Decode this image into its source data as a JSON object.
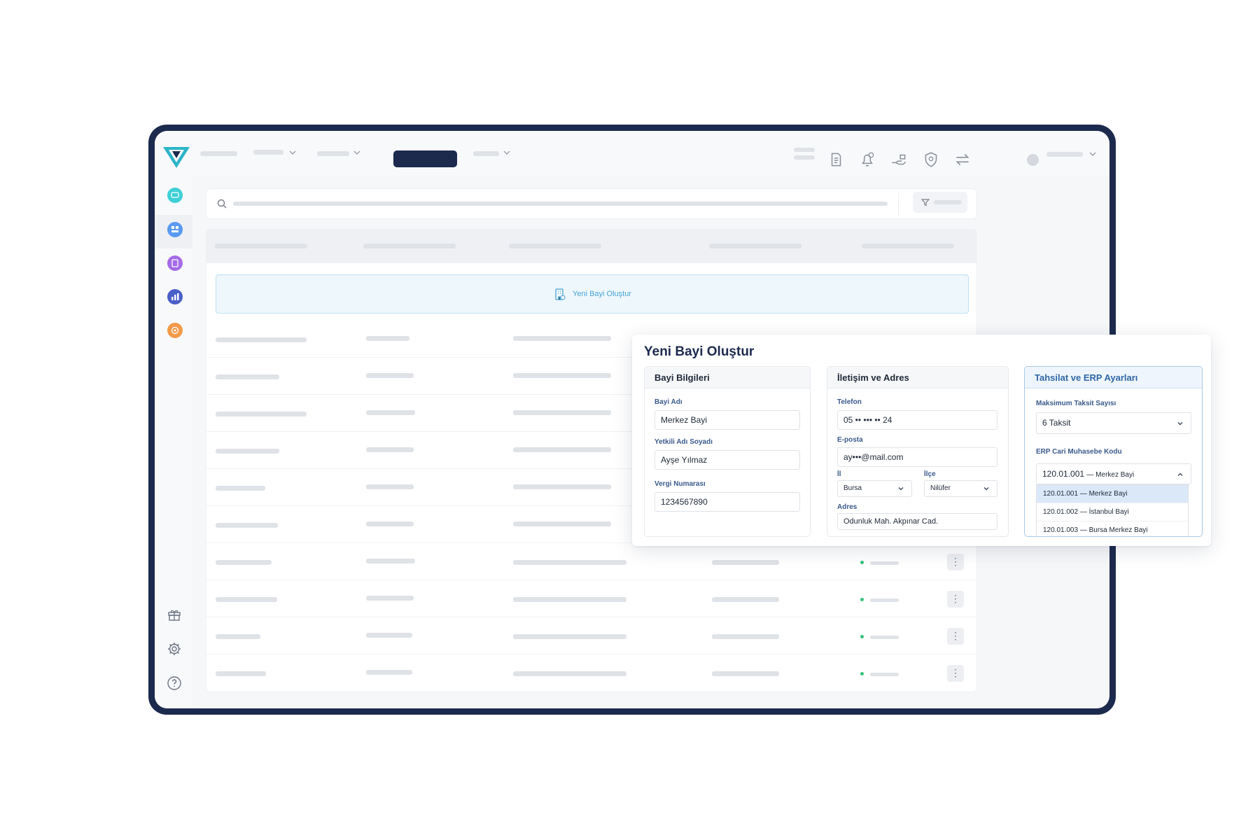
{
  "colors": {
    "navy": "#1c2a4e",
    "accent_blue": "#4aa4d8",
    "status_green": "#36c07a"
  },
  "create_bar": {
    "label": "Yeni Bayi Oluştur"
  },
  "modal": {
    "title": "Yeni Bayi Oluştur",
    "sections": {
      "dealer": {
        "title": "Bayi Bilgileri",
        "name_label": "Bayi Adı",
        "name_value": "Merkez Bayi",
        "contact_label": "Yetkili Adı Soyadı",
        "contact_value": "Ayşe Yılmaz",
        "tax_label": "Vergi Numarası",
        "tax_value": "1234567890"
      },
      "contact": {
        "title": "İletişim ve Adres",
        "phone_label": "Telefon",
        "phone_value": "05 •• ••• •• 24",
        "email_label": "E-posta",
        "email_value": "ay•••@mail.com",
        "city_label": "İl",
        "city_value": "Bursa",
        "district_label": "İlçe",
        "district_value": "Nilüfer",
        "address_label": "Adres",
        "address_value": "Odunluk Mah. Akpınar Cad."
      },
      "erp": {
        "title": "Tahsilat ve ERP Ayarları",
        "installment_label": "Maksimum Taksit Sayısı",
        "installment_value": "6 Taksit",
        "erp_label": "ERP Cari Muhasebe Kodu",
        "erp_value_code": "120.01.001",
        "erp_value_name": "— Merkez Bayi",
        "options": [
          "120.01.001 — Merkez Bayi",
          "120.01.002 — İstanbul Bayi",
          "120.01.003 — Bursa Merkez Bayi"
        ]
      }
    }
  }
}
